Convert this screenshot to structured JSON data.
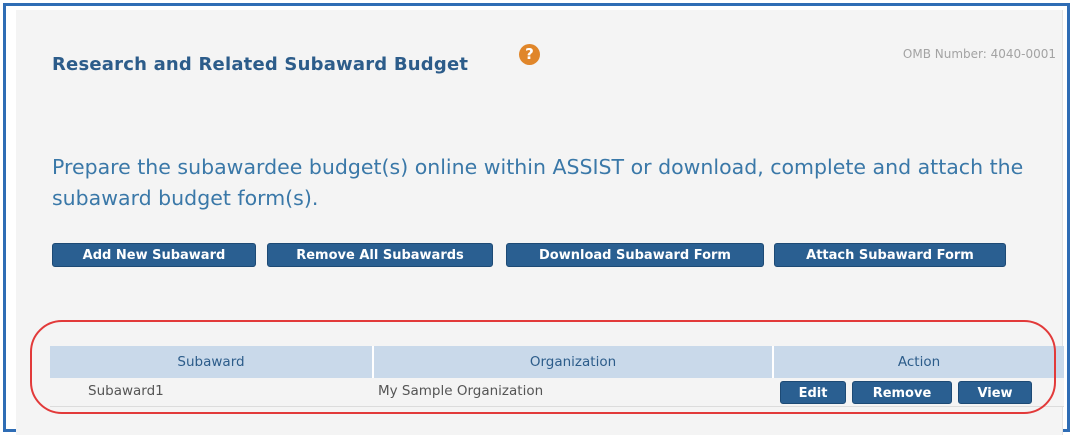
{
  "form": {
    "title": "Research and Related Subaward Budget",
    "help_glyph": "?",
    "omb_number": "OMB Number: 4040-0001",
    "instructions": "Prepare the subawardee budget(s) online within ASSIST or download, complete and attach the subaward budget form(s)."
  },
  "toolbar": {
    "add_label": "Add New Subaward",
    "remove_all_label": "Remove All Subawards",
    "download_label": "Download Subaward Form",
    "attach_label": "Attach Subaward Form"
  },
  "table": {
    "headers": [
      "Subaward",
      "Organization",
      "Action"
    ],
    "rows": [
      {
        "subaward": "Subaward1",
        "organization": "My Sample Organization",
        "actions": [
          "Edit",
          "Remove",
          "View"
        ]
      }
    ]
  },
  "colors": {
    "accent": "#2a5f91",
    "title": "#2c5c8a",
    "instructions": "#3a78a8",
    "table_header": "#c9d9ea",
    "help_icon": "#e0862a",
    "highlight": "#e23a3a"
  },
  "icons": {
    "help": "question-circle-icon"
  }
}
